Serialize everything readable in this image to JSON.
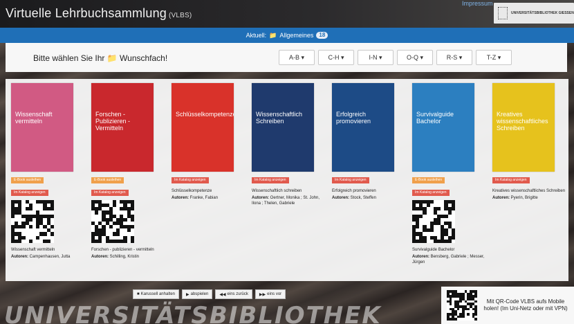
{
  "header": {
    "title": "Virtuelle Lehrbuchsammlung",
    "title_abbr": "(VLBS)",
    "top_link": "Impressum",
    "logo_text": "UNIVERSITÄTSBIBLIOTHEK GIESSEN"
  },
  "status": {
    "prefix": "Aktuell:",
    "current": "Allgemeines",
    "count": "18"
  },
  "subject": {
    "label": "Bitte wählen Sie Ihr",
    "label_suffix": "Wunschfach!",
    "ranges": [
      "A-B",
      "C-H",
      "I-N",
      "O-Q",
      "R-S",
      "T-Z"
    ]
  },
  "books": [
    {
      "cover_title": "Wissenschaft vermitteln",
      "cover_color": "#d15a83",
      "tags": [
        {
          "text": "E-Book ausleihen",
          "color": "orange"
        },
        {
          "text": "Im Katalog anzeigen",
          "color": "red"
        }
      ],
      "title": "Wissenschaft vermitteln",
      "authors_label": "Autoren:",
      "authors": "Campenhausen, Jutta",
      "has_qr": true
    },
    {
      "cover_title": "Forschen - Publizieren - Vermitteln",
      "cover_color": "#c9282d",
      "tags": [
        {
          "text": "E-Book ausleihen",
          "color": "orange"
        },
        {
          "text": "Im Katalog anzeigen",
          "color": "red"
        }
      ],
      "title": "Forschen - publizieren - vermitteln",
      "authors_label": "Autoren:",
      "authors": "Schilling, Kristin",
      "has_qr": true
    },
    {
      "cover_title": "Schlüsselkompetenzen",
      "cover_color": "#d9322a",
      "tags": [
        {
          "text": "Im Katalog anzeigen",
          "color": "red"
        }
      ],
      "title": "Schlüsselkompetenze",
      "authors_label": "Autoren:",
      "authors": "Franke, Fabian",
      "has_qr": false
    },
    {
      "cover_title": "Wissenschaftlich Schreiben",
      "cover_color": "#1f3a6d",
      "tags": [
        {
          "text": "Im Katalog anzeigen",
          "color": "red"
        }
      ],
      "title": "Wissenschaftlich schreiben",
      "authors_label": "Autoren:",
      "authors": "Oertner, Monika ; St. John, Ilona ; Thelen, Gabriele",
      "has_qr": false
    },
    {
      "cover_title": "Erfolgreich promovieren",
      "cover_color": "#1d4b86",
      "tags": [
        {
          "text": "Im Katalog anzeigen",
          "color": "red"
        }
      ],
      "title": "Erfolgreich promovieren",
      "authors_label": "Autoren:",
      "authors": "Stock, Steffen",
      "has_qr": false
    },
    {
      "cover_title": "Survivalguide Bachelor",
      "cover_color": "#2c7fc0",
      "tags": [
        {
          "text": "E-Book ausleihen",
          "color": "orange"
        },
        {
          "text": "Im Katalog anzeigen",
          "color": "red"
        }
      ],
      "title": "Survivalguide Bachelor",
      "authors_label": "Autoren:",
      "authors": "Bensberg, Gabriele ; Messer, Jürgen",
      "has_qr": true
    },
    {
      "cover_title": "Kreatives wissenschaftliches Schreiben",
      "cover_color": "#e6c21d",
      "tags": [
        {
          "text": "Im Katalog anzeigen",
          "color": "red"
        }
      ],
      "title": "Kreatives wissenschaftliches Schreiben",
      "authors_label": "Autoren:",
      "authors": "Pyerin, Brigitte",
      "has_qr": false
    }
  ],
  "controls": [
    {
      "icon": "■",
      "label": "Karussell anhalten"
    },
    {
      "icon": "▶",
      "label": "abspielen"
    },
    {
      "icon": "◀◀",
      "label": "eins zurück"
    },
    {
      "icon": "▶▶",
      "label": "eins vor"
    }
  ],
  "footer": {
    "watermark": "UNIVERSITÄTSBIBLIOTHEK",
    "mobile_text": "Mit QR-Code VLBS aufs Mobile holen! (Im Uni-Netz oder mit VPN)"
  }
}
